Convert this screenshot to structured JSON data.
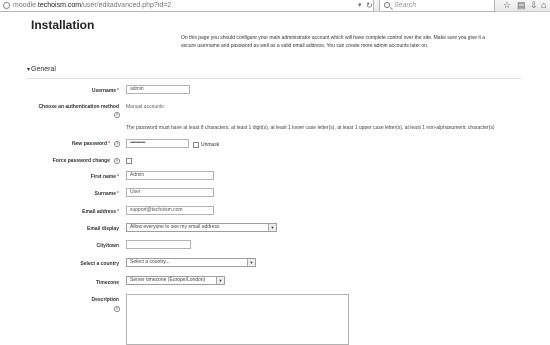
{
  "browser": {
    "url_prefix": "moodle.",
    "url_domain": "techoism.com",
    "url_path": "/user/editadvanced.php?id=2",
    "url_dropdown_icon": "chevron-down-icon",
    "reload_icon": "reload-icon",
    "search_placeholder": "Search",
    "toolbar_icons": [
      "star-icon",
      "clipboard-icon",
      "download-icon",
      "home-icon"
    ]
  },
  "page": {
    "title": "Installation",
    "intro": "On this page you should configure your main administrator account which will have complete control over the site. Make sure you give it a secure username and password as well as a valid email address. You can create more admin accounts later on."
  },
  "section": {
    "toggle": "▾",
    "title": "General"
  },
  "form": {
    "required_mark": "*",
    "help_glyph": "?",
    "username": {
      "label": "Username",
      "value": "admin"
    },
    "auth": {
      "label": "Choose an authentication method",
      "value": "Manual accounts"
    },
    "password_rule": "The password must have at least 8 characters, at least 1 digit(s), at least 1 lower case letter(s), at least 1 upper case letter(s), at least 1 non-alphanumeric character(s)",
    "new_password": {
      "label": "New password",
      "value": "••••••••••••",
      "unmask_label": "Unmask"
    },
    "force_change": {
      "label": "Force password change"
    },
    "first_name": {
      "label": "First name",
      "value": "Admin"
    },
    "surname": {
      "label": "Surname",
      "value": "User"
    },
    "email": {
      "label": "Email address",
      "value": "support@techoism.com"
    },
    "email_display": {
      "label": "Email display",
      "value": "Allow everyone to see my email address"
    },
    "city": {
      "label": "City/town",
      "value": ""
    },
    "country": {
      "label": "Select a country",
      "value": "Select a country..."
    },
    "timezone": {
      "label": "Timezone",
      "value": "Server timezone (Europe/London)"
    },
    "description": {
      "label": "Description"
    }
  }
}
